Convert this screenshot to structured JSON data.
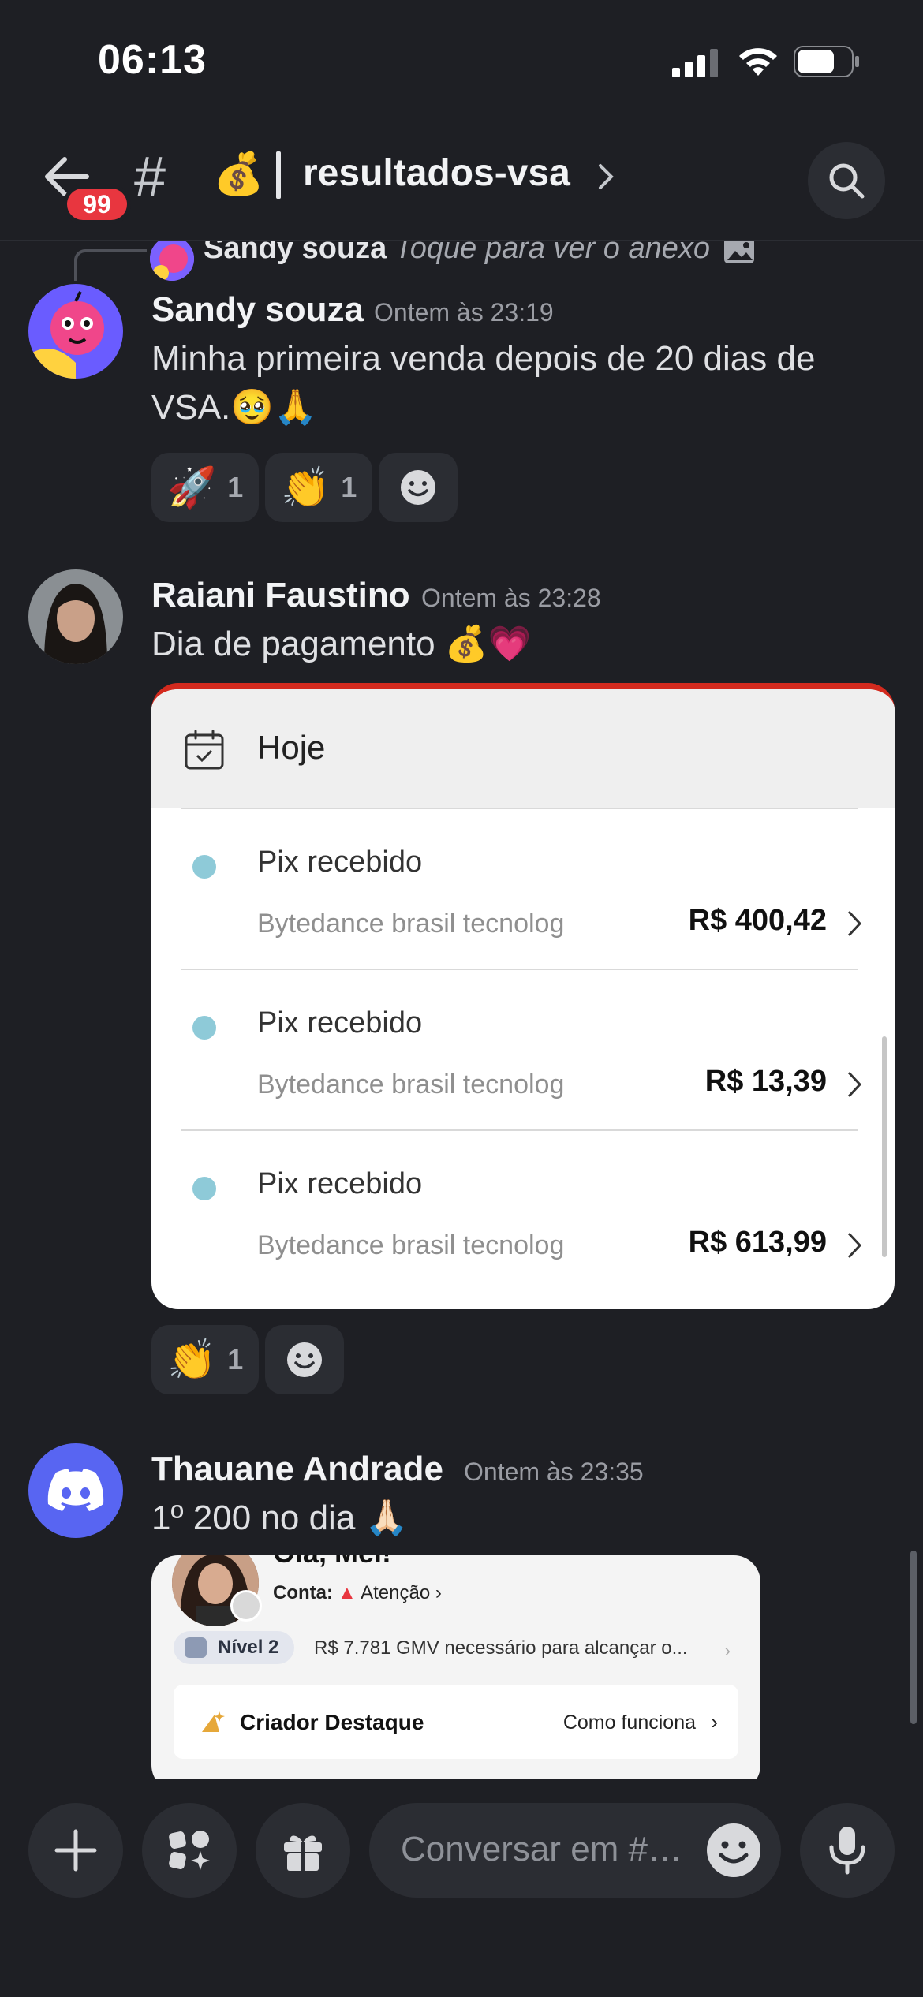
{
  "status_bar": {
    "time": "06:13"
  },
  "header": {
    "unread_badge": "99",
    "hash_symbol": "#",
    "channel_emoji": "💰",
    "channel_name": "resultados-vsa"
  },
  "messages": [
    {
      "reply": {
        "author": "Sandy souza",
        "text": "Toque para ver o anexo"
      },
      "author": "Sandy souza",
      "timestamp": "Ontem às 23:19",
      "text_line1": "Minha primeira venda depois de 20 dias de",
      "text_line2": "VSA.🥹🙏",
      "reactions": [
        {
          "emoji": "🚀",
          "count": "1"
        },
        {
          "emoji": "👏",
          "count": "1"
        }
      ]
    },
    {
      "author": "Raiani Faustino",
      "timestamp": "Ontem às 23:28",
      "text": "Dia de pagamento 💰💗",
      "attachment": {
        "header": "Hoje",
        "transactions": [
          {
            "title": "Pix recebido",
            "source": "Bytedance brasil tecnolog",
            "amount": "R$ 400,42"
          },
          {
            "title": "Pix recebido",
            "source": "Bytedance brasil tecnolog",
            "amount": "R$ 13,39"
          },
          {
            "title": "Pix recebido",
            "source": "Bytedance brasil tecnolog",
            "amount": "R$ 613,99"
          }
        ]
      },
      "reactions": [
        {
          "emoji": "👏",
          "count": "1"
        }
      ]
    },
    {
      "author": "Thauane Andrade",
      "timestamp": "Ontem às 23:35",
      "text": "1º 200 no dia 🙏🏻",
      "attachment": {
        "greeting": "Olá, Mel!",
        "account_label": "Conta:",
        "account_status": "Atenção",
        "level": "Nível 2",
        "gmv_text": "R$ 7.781 GMV necessário para alcançar o...",
        "feature_title": "Criador Destaque",
        "feature_link": "Como funciona"
      }
    }
  ],
  "composer": {
    "placeholder": "Conversar em #…"
  },
  "colors": {
    "background": "#1e1f24",
    "surface": "#2b2d33",
    "badge_red": "#e8363f",
    "discord_blurple": "#5865f2",
    "bank_accent": "#d32a1e",
    "pix_dot": "#8ecad8"
  },
  "icons": [
    "back-arrow-icon",
    "hash-icon",
    "chevron-right-icon",
    "search-icon",
    "image-icon",
    "add-reaction-icon",
    "calendar-icon",
    "plus-icon",
    "apps-icon",
    "gift-icon",
    "emoji-icon",
    "microphone-icon"
  ]
}
